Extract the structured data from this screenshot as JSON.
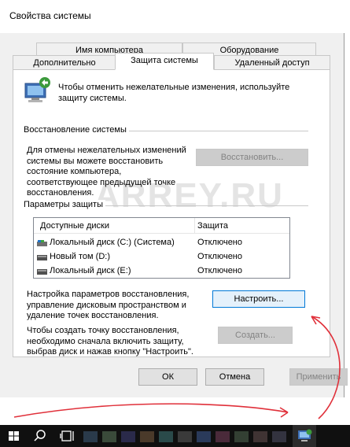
{
  "window": {
    "title": "Свойства системы"
  },
  "tabs": {
    "row1": [
      "Имя компьютера",
      "Оборудование"
    ],
    "row2": [
      "Дополнительно",
      "Защита системы",
      "Удаленный доступ"
    ],
    "active": "Защита системы"
  },
  "intro": {
    "text": "Чтобы отменить нежелательные изменения, используйте защиту системы."
  },
  "restore": {
    "section_label": "Восстановление системы",
    "text": "Для отмены нежелательных изменений системы вы можете восстановить состояние компьютера, соответствующее предыдущей точке восстановления.",
    "button": "Восстановить..."
  },
  "protection": {
    "section_label": "Параметры защиты",
    "columns": [
      "Доступные диски",
      "Защита"
    ],
    "drives": [
      {
        "name": "Локальный диск (C:) (Система)",
        "status": "Отключено"
      },
      {
        "name": "Новый том (D:)",
        "status": "Отключено"
      },
      {
        "name": "Локальный диск (E:)",
        "status": "Отключено"
      }
    ],
    "configure_text": "Настройка параметров восстановления, управление дисковым пространством и удаление точек восстановления.",
    "configure_button": "Настроить...",
    "create_text": "Чтобы создать точку восстановления, необходимо сначала включить защиту, выбрав диск и нажав кнопку \"Настроить\".",
    "create_button": "Создать..."
  },
  "footer": {
    "ok": "ОК",
    "cancel": "Отмена",
    "apply": "Применить"
  },
  "watermark": "ARREY.RU",
  "colors": {
    "accent": "#0078d7",
    "arrow": "#e0303a",
    "taskbar": "#101010"
  }
}
